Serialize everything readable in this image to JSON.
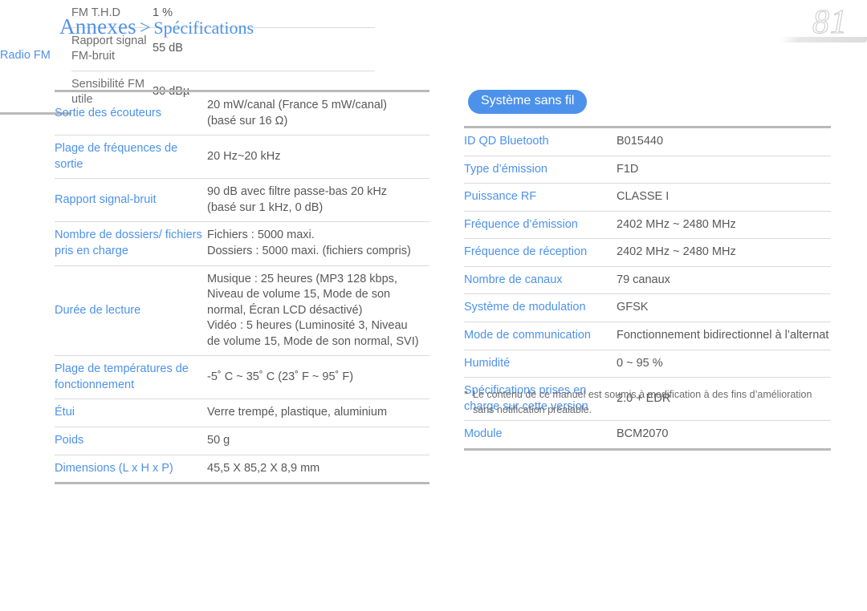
{
  "header": {
    "main": "Annexes",
    "separator": ">",
    "sub": "Spécifications",
    "page_number": "81",
    "accent_color": "#4d92ea",
    "rule_color": "#b9b9b9"
  },
  "left_table": {
    "rows": [
      {
        "label": "Sortie des écouteurs",
        "value": "20 mW/canal (France 5 mW/canal)\n(basé sur 16 Ω)"
      },
      {
        "label": "Plage de fréquences de sortie",
        "value": "20 Hz~20 kHz"
      },
      {
        "label": "Rapport signal-bruit",
        "value": "90 dB avec filtre passe-bas 20 kHz\n(basé sur 1 kHz, 0 dB)"
      },
      {
        "label": "Nombre de dossiers/ fichiers pris en charge",
        "value": "Fichiers : 5000 maxi.\nDossiers : 5000 maxi. (fichiers compris)"
      },
      {
        "label": "Durée de lecture",
        "value": "Musique : 25 heures (MP3 128 kbps,\nNiveau de volume 15, Mode de son\nnormal, Écran LCD désactivé)\nVidéo : 5 heures (Luminosité 3, Niveau\nde volume 15, Mode de son normal, SVI)"
      },
      {
        "label": "Plage de températures de fonctionnement",
        "value": "-5˚ C ~ 35˚ C (23˚ F ~ 95˚ F)"
      },
      {
        "label": "Étui",
        "value": "Verre trempé, plastique, aluminium"
      },
      {
        "label": "Poids",
        "value": "50 g"
      },
      {
        "label": "Dimensions (L x H x P)",
        "value": "45,5 X 85,2 X 8,9 mm"
      }
    ],
    "radio_group": {
      "label": "Radio FM",
      "rows": [
        {
          "sublabel": "FM T.H.D",
          "value": "1 %"
        },
        {
          "sublabel": "Rapport signal FM-bruit",
          "value": "55 dB"
        },
        {
          "sublabel": "Sensibilité FM utile",
          "value": "30 dBµ"
        }
      ]
    }
  },
  "right_section": {
    "badge": "Système sans fil",
    "rows": [
      {
        "label": "ID QD Bluetooth",
        "value": "B015440"
      },
      {
        "label": "Type d’émission",
        "value": "F1D"
      },
      {
        "label": "Puissance RF",
        "value": "CLASSE I"
      },
      {
        "label": "Fréquence d’émission",
        "value": "2402 MHz ~ 2480 MHz"
      },
      {
        "label": "Fréquence de réception",
        "value": "2402 MHz ~ 2480 MHz"
      },
      {
        "label": "Nombre de canaux",
        "value": "79 canaux"
      },
      {
        "label": "Système de modulation",
        "value": "GFSK"
      },
      {
        "label": "Mode de communication",
        "value": "Fonctionnement bidirectionnel à l’alternat"
      },
      {
        "label": "Humidité",
        "value": "0 ~ 95 %"
      },
      {
        "label": "Spécifications prises en charge sur cette version",
        "value": "2.0 + EDR"
      },
      {
        "label": "Module",
        "value": "BCM2070"
      }
    ],
    "footnote": {
      "marker": "*",
      "line1": "Le contenu de ce manuel est soumis à modification à des fins d’amélioration",
      "line2": "sans notification préalable."
    }
  }
}
